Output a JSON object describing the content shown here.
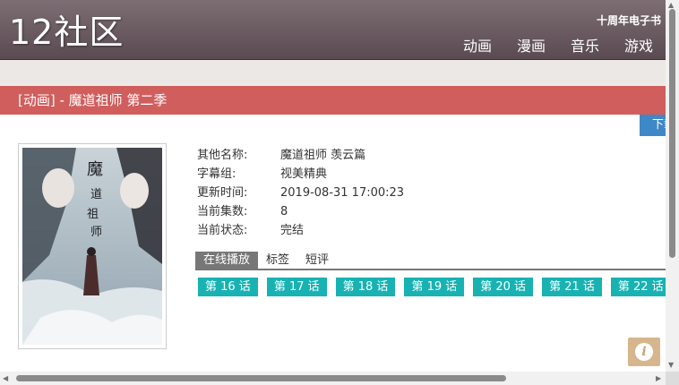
{
  "header": {
    "logo": "12社区",
    "tagline": "十周年电子书",
    "nav": [
      "动画",
      "漫画",
      "音乐",
      "游戏"
    ]
  },
  "title": "[动画] - 魔道祖师 第二季",
  "download_label": "下载",
  "info": [
    {
      "label": "其他名称:",
      "value": "魔道祖师 羡云篇"
    },
    {
      "label": "字幕组:",
      "value": "视美精典"
    },
    {
      "label": "更新时间:",
      "value": "2019-08-31 17:00:23"
    },
    {
      "label": "当前集数:",
      "value": "8"
    },
    {
      "label": "当前状态:",
      "value": "完结"
    }
  ],
  "tabs": [
    "在线播放",
    "标签",
    "短评"
  ],
  "episodes": [
    "第 16 话",
    "第 17 话",
    "第 18 话",
    "第 19 话",
    "第 20 话",
    "第 21 话",
    "第 22 话"
  ],
  "cover_text": "魔道祖师",
  "colors": {
    "header": "#6a5a61",
    "title_bar": "#d05e5d",
    "episode": "#18b2b2",
    "download": "#3f88c8",
    "info_button": "#d6b68c"
  },
  "icons": {
    "info": "info-icon",
    "scroll_up": "arrow-up-icon",
    "scroll_down": "arrow-down-icon",
    "scroll_left": "arrow-left-icon",
    "scroll_right": "arrow-right-icon"
  }
}
